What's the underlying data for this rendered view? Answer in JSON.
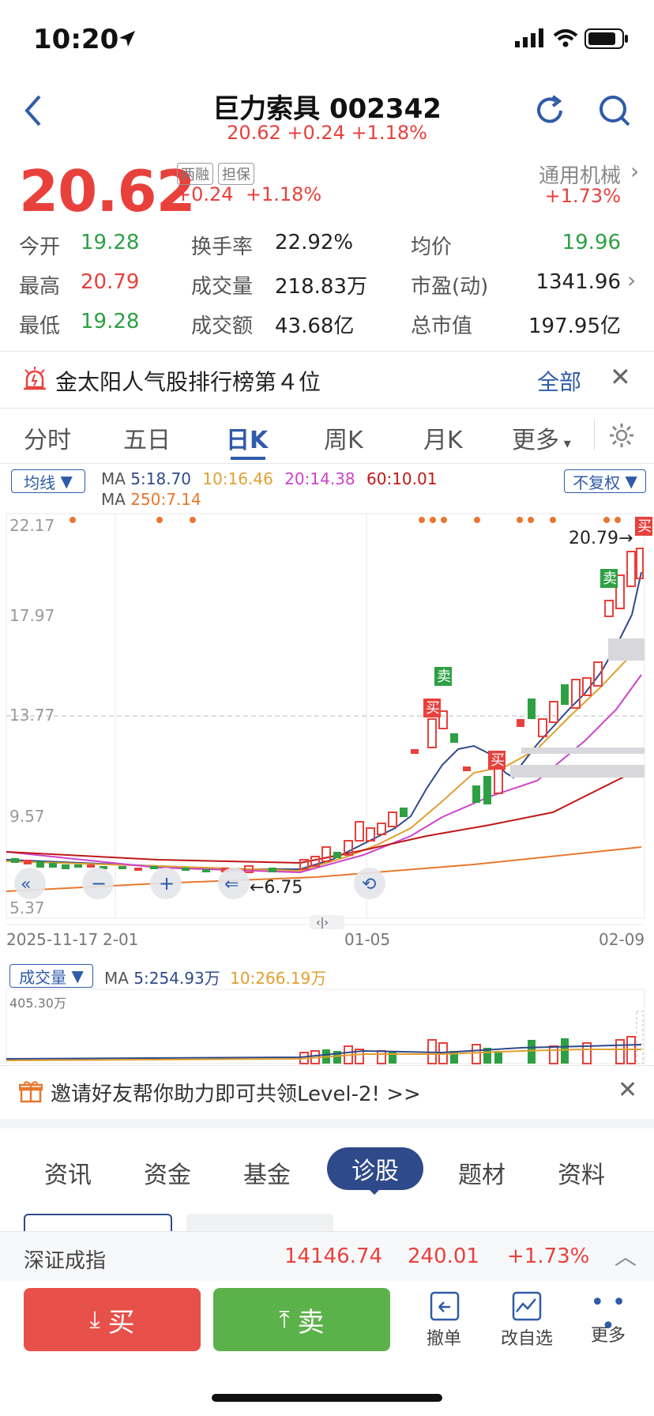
{
  "status": {
    "time": "10:20"
  },
  "header": {
    "title": "巨力索具 002342",
    "price_line": "20.62 +0.24 +1.18%"
  },
  "quote": {
    "price": "20.62",
    "change": "+0.24",
    "change_pct": "+1.18%",
    "badges": [
      "两融",
      "担保"
    ],
    "sector": "通用机械",
    "sector_change": "+1.73%"
  },
  "stats": [
    {
      "label": "今开",
      "value": "19.28",
      "color": "green"
    },
    {
      "label": "换手率",
      "value": "22.92%",
      "color": "black"
    },
    {
      "label": "均价",
      "value": "19.96",
      "color": "green"
    },
    {
      "label": "最高",
      "value": "20.79",
      "color": "red"
    },
    {
      "label": "成交量",
      "value": "218.83万",
      "color": "black"
    },
    {
      "label": "市盈(动)",
      "value": "1341.96",
      "color": "black"
    },
    {
      "label": "最低",
      "value": "19.28",
      "color": "green"
    },
    {
      "label": "成交额",
      "value": "43.68亿",
      "color": "black"
    },
    {
      "label": "总市值",
      "value": "197.95亿",
      "color": "black"
    }
  ],
  "banner": {
    "text": "金太阳人气股排行榜第４位",
    "link": "全部"
  },
  "chart_tabs": [
    "分时",
    "五日",
    "日K",
    "周K",
    "月K",
    "更多"
  ],
  "active_tab": "日K",
  "ma_bar": {
    "dropdown": "均线",
    "ma_prefix": "MA",
    "ma5": "5:18.70",
    "ma10": "10:16.46",
    "ma20": "20:14.38",
    "ma60": "60:10.01",
    "ma250_prefix": "MA",
    "ma250": "250:7.14",
    "adjust": "不复权"
  },
  "chart_data": {
    "type": "candlestick",
    "y_ticks": [
      "22.17",
      "17.97",
      "13.77",
      "9.57",
      "5.37"
    ],
    "x_ticks": [
      "2025-11-17",
      "2-01",
      "01-05",
      "02-09"
    ],
    "max_label": "20.79→",
    "min_label": "←6.75",
    "signal_labels": [
      "买",
      "卖",
      "买",
      "买",
      "卖",
      "买"
    ]
  },
  "volume": {
    "dropdown": "成交量",
    "ma_prefix": "MA",
    "ma5": "5:254.93万",
    "ma10": "10:266.19万",
    "max_label": "405.30万"
  },
  "promo": {
    "text": "邀请好友帮你助力即可共领Level-2! >>"
  },
  "sub_tabs": [
    "资讯",
    "资金",
    "基金",
    "诊股",
    "题材",
    "资料"
  ],
  "active_sub_tab": "诊股",
  "index_bar": {
    "name": "深证成指",
    "value": "14146.74",
    "change": "240.01",
    "pct": "+1.73%"
  },
  "actions": {
    "buy": "买",
    "sell": "卖",
    "cancel": "撤单",
    "watch": "改自选",
    "more": "更多"
  },
  "colors": {
    "up": "#e8413c",
    "down": "#2ea043",
    "accent": "#2f5ba8"
  }
}
